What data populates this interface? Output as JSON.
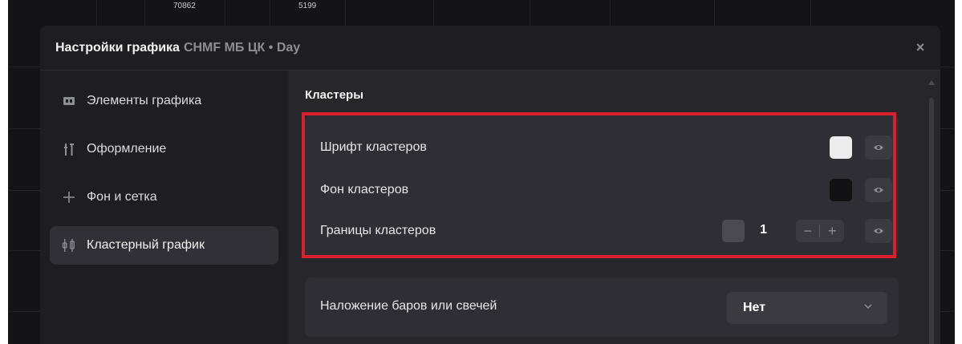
{
  "background_chart": {
    "labels": [
      "70862",
      "5199"
    ]
  },
  "dialog": {
    "title": "Настройки графика",
    "subtitle": "CHMF МБ ЦК • Day",
    "close_icon": "close-icon",
    "close_glyph": "×"
  },
  "sidebar": {
    "items": [
      {
        "label": "Элементы графика",
        "icon": "chart-elements-icon",
        "active": false
      },
      {
        "label": "Оформление",
        "icon": "appearance-icon",
        "active": false
      },
      {
        "label": "Фон и сетка",
        "icon": "plus-icon",
        "active": false
      },
      {
        "label": "Кластерный график",
        "icon": "cluster-chart-icon",
        "active": true
      }
    ]
  },
  "main": {
    "section_title": "Кластеры",
    "rows": [
      {
        "label": "Шрифт кластеров",
        "color": "#ececec"
      },
      {
        "label": "Фон кластеров",
        "color": "#121214"
      },
      {
        "label": "Границы кластеров",
        "color": "#4a4a50",
        "value": "1",
        "minus": "−",
        "plus": "+"
      }
    ],
    "overlay": {
      "label": "Наложение баров или свечей",
      "selected": "Нет"
    }
  },
  "colors": {
    "highlight": "#d9202c",
    "eye_icon": "#8d8d94"
  }
}
